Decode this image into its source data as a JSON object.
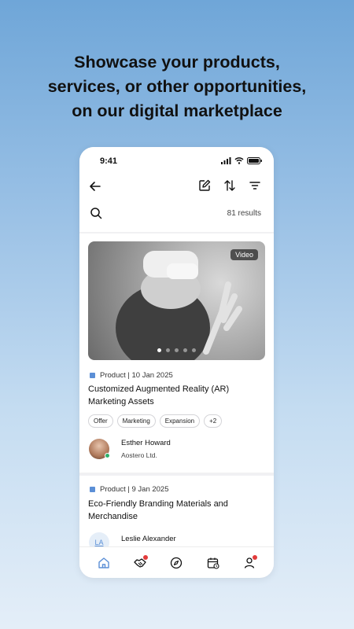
{
  "headline": {
    "line1": "Showcase your products,",
    "line2": "services, or other opportunities,",
    "line3": "on our digital marketplace"
  },
  "status_bar": {
    "time": "9:41"
  },
  "search": {
    "results": "81 results"
  },
  "listings": [
    {
      "media_badge": "Video",
      "media_icon": "image",
      "carousel": {
        "count": 5,
        "active": 1
      },
      "meta": "Product | 10 Jan 2025",
      "title": "Customized Augmented Reality (AR) Marketing Assets",
      "tags": [
        "Offer",
        "Marketing",
        "Expansion",
        "+2"
      ],
      "author": {
        "name": "Esther Howard",
        "company": "Aostero Ltd.",
        "online": true
      }
    },
    {
      "meta": "Product | 9 Jan 2025",
      "title": "Eco-Friendly Branding Materials and Merchandise",
      "author": {
        "name": "Leslie Alexander",
        "initials": "LA"
      }
    }
  ],
  "tabs": [
    "home-icon",
    "handshake-icon",
    "compass-icon",
    "calendar-icon",
    "profile-icon"
  ],
  "colors": {
    "accent": "#5b8fd6",
    "online": "#2fb16b",
    "notification": "#e23b3b"
  }
}
